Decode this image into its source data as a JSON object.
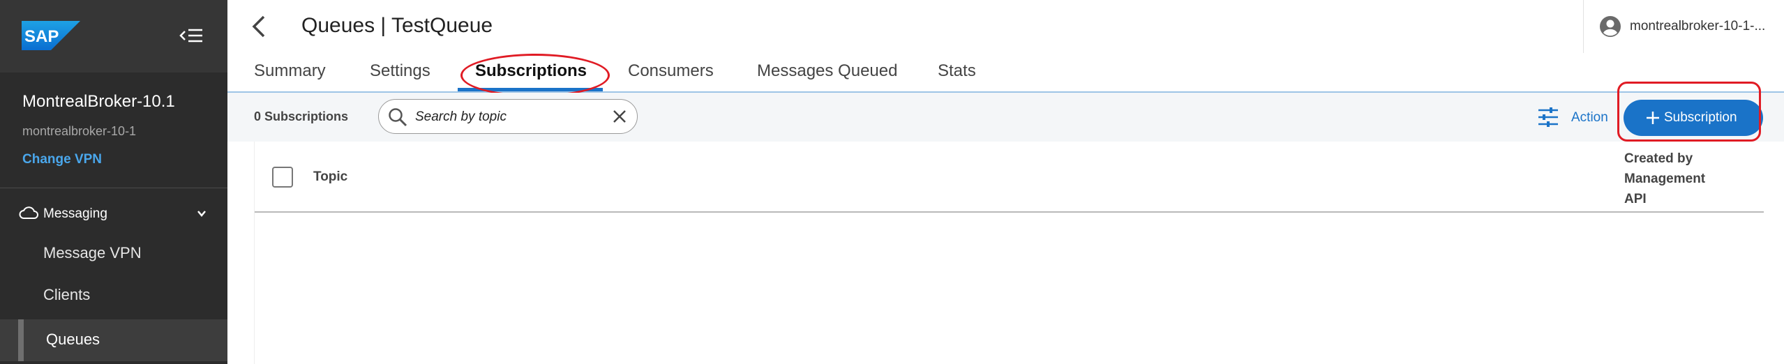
{
  "sidebar": {
    "logo_text": "SAP",
    "broker_name": "MontrealBroker-10.1",
    "broker_sub": "montrealbroker-10-1",
    "change_vpn": "Change VPN",
    "section": {
      "label": "Messaging",
      "icon": "cloud-icon"
    },
    "items": [
      {
        "label": "Message VPN"
      },
      {
        "label": "Clients"
      },
      {
        "label": "Queues",
        "active": true
      }
    ]
  },
  "header": {
    "title": "Queues | TestQueue",
    "user": "montrealbroker-10-1-..."
  },
  "tabs": [
    {
      "label": "Summary"
    },
    {
      "label": "Settings"
    },
    {
      "label": "Subscriptions",
      "active": true
    },
    {
      "label": "Consumers"
    },
    {
      "label": "Messages Queued"
    },
    {
      "label": "Stats"
    }
  ],
  "toolbar": {
    "count": "0 Subscriptions",
    "search_placeholder": "Search by topic",
    "action_label": "Action",
    "add_label": "Subscription"
  },
  "table": {
    "columns": [
      "Topic",
      "Created by Management API"
    ],
    "rows": []
  },
  "colors": {
    "sidebar_bg": "#2c2c2c",
    "accent": "#1a73c8",
    "link": "#4aa7ec",
    "highlight": "#e01b24"
  }
}
